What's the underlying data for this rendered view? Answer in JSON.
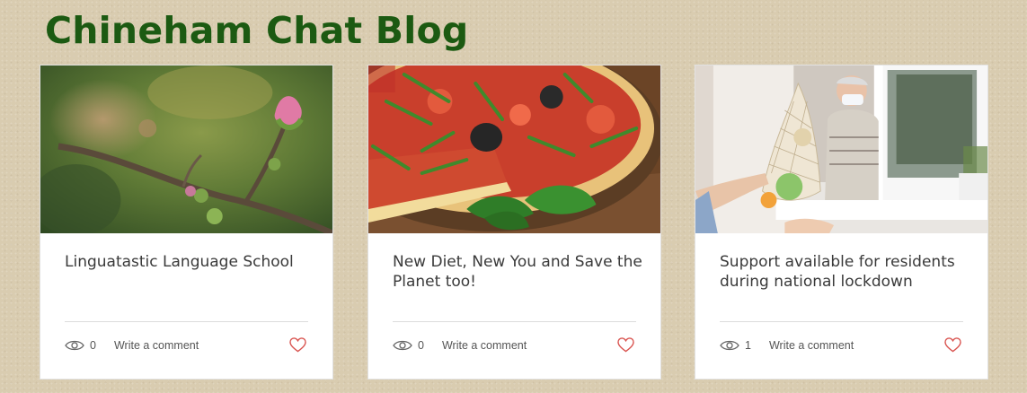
{
  "blog": {
    "title": "Chineham Chat Blog"
  },
  "colors": {
    "title": "#1c5a12",
    "heart": "#d9534f",
    "background": "#d9ccb0"
  },
  "posts": [
    {
      "title": "Linguatastic Language School",
      "views": "0",
      "comment_label": "Write a comment",
      "image": "pink-blossom-branch"
    },
    {
      "title": "New Diet, New You and Save the Planet too!",
      "views": "0",
      "comment_label": "Write a comment",
      "image": "pizza-with-rocket"
    },
    {
      "title": "Support available for residents during national lockdown",
      "views": "1",
      "comment_label": "Write a comment",
      "image": "grocery-delivery-window"
    }
  ],
  "icons": {
    "views": "eye-icon",
    "like": "heart-icon"
  }
}
